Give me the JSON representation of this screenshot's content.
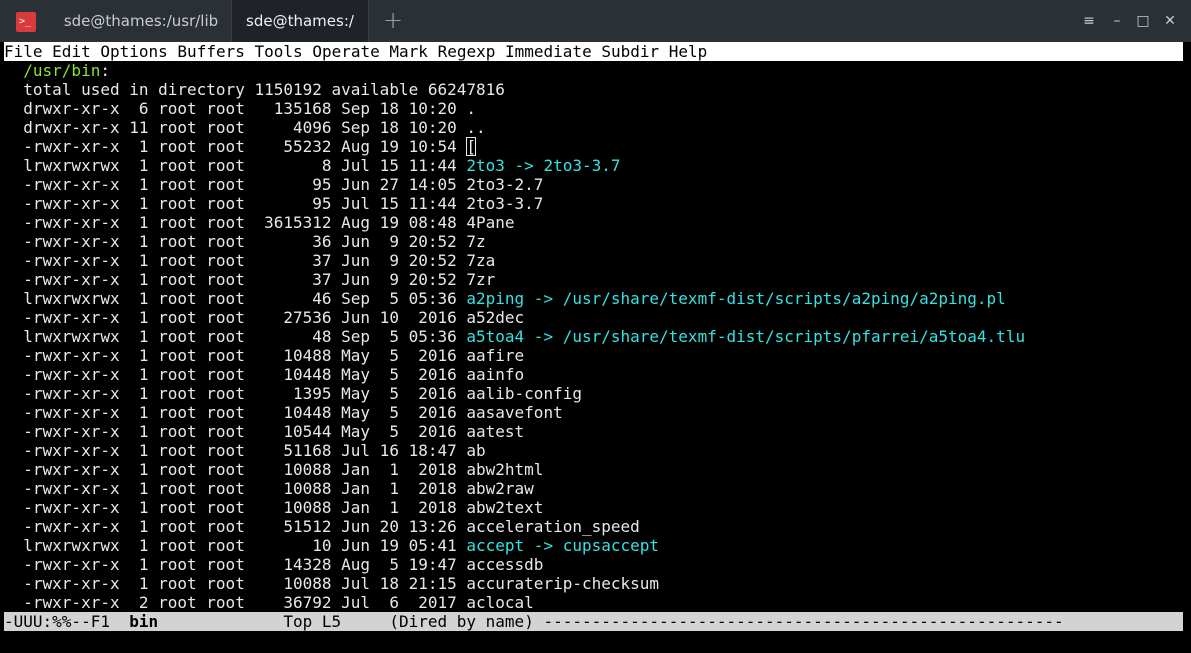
{
  "tabs": [
    {
      "label": "sde@thames:/usr/lib"
    },
    {
      "label": "sde@thames:/"
    }
  ],
  "titlebar": {
    "app_icon_glyph": ">_",
    "new_tab_glyph": "+",
    "menu_glyph": "≡",
    "minimize_glyph": "–",
    "maximize_glyph": "□",
    "close_glyph": "✕"
  },
  "menu": [
    "File",
    "Edit",
    "Options",
    "Buffers",
    "Tools",
    "Operate",
    "Mark",
    "Regexp",
    "Immediate",
    "Subdir",
    "Help"
  ],
  "dired": {
    "header": "/usr/bin",
    "header_suffix": ":",
    "total": "total used in directory 1150192 available 66247816",
    "entries": [
      {
        "meta": "drwxr-xr-x  6 root root   135168 Sep 18 10:20 ",
        "name": ".",
        "link": false
      },
      {
        "meta": "drwxr-xr-x 11 root root     4096 Sep 18 10:20 ",
        "name": "..",
        "link": false
      },
      {
        "meta": "-rwxr-xr-x  1 root root    55232 Aug 19 10:54 ",
        "name": "[",
        "link": false,
        "cursor": true
      },
      {
        "meta": "lrwxrwxrwx  1 root root        8 Jul 15 11:44 ",
        "name": "2to3 -> 2to3-3.7",
        "link": true
      },
      {
        "meta": "-rwxr-xr-x  1 root root       95 Jun 27 14:05 ",
        "name": "2to3-2.7",
        "link": false
      },
      {
        "meta": "-rwxr-xr-x  1 root root       95 Jul 15 11:44 ",
        "name": "2to3-3.7",
        "link": false
      },
      {
        "meta": "-rwxr-xr-x  1 root root  3615312 Aug 19 08:48 ",
        "name": "4Pane",
        "link": false
      },
      {
        "meta": "-rwxr-xr-x  1 root root       36 Jun  9 20:52 ",
        "name": "7z",
        "link": false
      },
      {
        "meta": "-rwxr-xr-x  1 root root       37 Jun  9 20:52 ",
        "name": "7za",
        "link": false
      },
      {
        "meta": "-rwxr-xr-x  1 root root       37 Jun  9 20:52 ",
        "name": "7zr",
        "link": false
      },
      {
        "meta": "lrwxrwxrwx  1 root root       46 Sep  5 05:36 ",
        "name": "a2ping -> /usr/share/texmf-dist/scripts/a2ping/a2ping.pl",
        "link": true
      },
      {
        "meta": "-rwxr-xr-x  1 root root    27536 Jun 10  2016 ",
        "name": "a52dec",
        "link": false
      },
      {
        "meta": "lrwxrwxrwx  1 root root       48 Sep  5 05:36 ",
        "name": "a5toa4 -> /usr/share/texmf-dist/scripts/pfarrei/a5toa4.tlu",
        "link": true
      },
      {
        "meta": "-rwxr-xr-x  1 root root    10488 May  5  2016 ",
        "name": "aafire",
        "link": false
      },
      {
        "meta": "-rwxr-xr-x  1 root root    10448 May  5  2016 ",
        "name": "aainfo",
        "link": false
      },
      {
        "meta": "-rwxr-xr-x  1 root root     1395 May  5  2016 ",
        "name": "aalib-config",
        "link": false
      },
      {
        "meta": "-rwxr-xr-x  1 root root    10448 May  5  2016 ",
        "name": "aasavefont",
        "link": false
      },
      {
        "meta": "-rwxr-xr-x  1 root root    10544 May  5  2016 ",
        "name": "aatest",
        "link": false
      },
      {
        "meta": "-rwxr-xr-x  1 root root    51168 Jul 16 18:47 ",
        "name": "ab",
        "link": false
      },
      {
        "meta": "-rwxr-xr-x  1 root root    10088 Jan  1  2018 ",
        "name": "abw2html",
        "link": false
      },
      {
        "meta": "-rwxr-xr-x  1 root root    10088 Jan  1  2018 ",
        "name": "abw2raw",
        "link": false
      },
      {
        "meta": "-rwxr-xr-x  1 root root    10088 Jan  1  2018 ",
        "name": "abw2text",
        "link": false
      },
      {
        "meta": "-rwxr-xr-x  1 root root    51512 Jun 20 13:26 ",
        "name": "acceleration_speed",
        "link": false
      },
      {
        "meta": "lrwxrwxrwx  1 root root       10 Jun 19 05:41 ",
        "name": "accept -> cupsaccept",
        "link": true
      },
      {
        "meta": "-rwxr-xr-x  1 root root    14328 Aug  5 19:47 ",
        "name": "accessdb",
        "link": false
      },
      {
        "meta": "-rwxr-xr-x  1 root root    10088 Jul 18 21:15 ",
        "name": "accuraterip-checksum",
        "link": false
      },
      {
        "meta": "-rwxr-xr-x  2 root root    36792 Jul  6  2017 ",
        "name": "aclocal",
        "link": false
      }
    ]
  },
  "modeline": {
    "status": "-UUU:%%--F1  ",
    "buffer": "bin",
    "position": "             Top L5     ",
    "mode": "(Dired by name)",
    "fill": " ------------------------------------------------------"
  },
  "colors": {
    "titlebar_bg": "#2b2f36",
    "active_tab_bg": "#1f2329",
    "app_icon": "#d93a3e",
    "terminal_bg": "#000000",
    "text": "#e8e8e8",
    "directory_header": "#8ae234",
    "symlink": "#34e2e2",
    "modeline_bg": "#d3d3d3"
  }
}
